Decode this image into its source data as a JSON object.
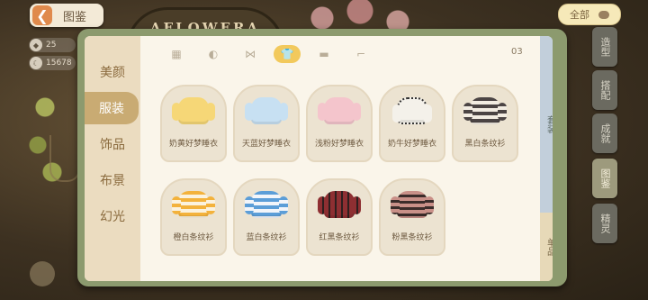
{
  "header": {
    "back_arrow": "❮",
    "title": "图鉴",
    "filter_label": "全部"
  },
  "background": {
    "sign_text": "AFLOWERA"
  },
  "stats": [
    {
      "icon": "shield-icon",
      "value": "25"
    },
    {
      "icon": "moon-icon",
      "value": "15678"
    }
  ],
  "right_tabs": [
    "造型",
    "搭配",
    "成就",
    "图鉴",
    "精灵"
  ],
  "categories": [
    "美颜",
    "服装",
    "饰品",
    "布景",
    "幻光"
  ],
  "active_category": "服装",
  "top_tabs": [
    {
      "icon": "grid-icon",
      "glyph": "▦"
    },
    {
      "icon": "hair-icon",
      "glyph": "◐"
    },
    {
      "icon": "bow-icon",
      "glyph": "⋈"
    },
    {
      "icon": "top-icon",
      "glyph": "👕"
    },
    {
      "icon": "bottom-icon",
      "glyph": "▬"
    },
    {
      "icon": "shoe-icon",
      "glyph": "⌐"
    }
  ],
  "active_top_tab": 3,
  "page_num": "03",
  "items": [
    {
      "name": "奶黄好梦睡衣",
      "color": "#f6d777"
    },
    {
      "name": "天蓝好梦睡衣",
      "color": "#c7e0f2"
    },
    {
      "name": "浅粉好梦睡衣",
      "color": "#f4c5cc"
    },
    {
      "name": "奶牛好梦睡衣",
      "color": "#f4f1ea"
    },
    {
      "name": "黑白条纹衫",
      "color": "#4b4444"
    },
    {
      "name": "橙白条纹衫",
      "color": "#f3b23c"
    },
    {
      "name": "蓝白条纹衫",
      "color": "#5c9ed8"
    },
    {
      "name": "红黑条纹衫",
      "color": "#8e2f32"
    },
    {
      "name": "粉黑条纹衫",
      "color": "#c99088"
    }
  ],
  "side_tabs": {
    "top": "套装",
    "bottom": "单品"
  }
}
